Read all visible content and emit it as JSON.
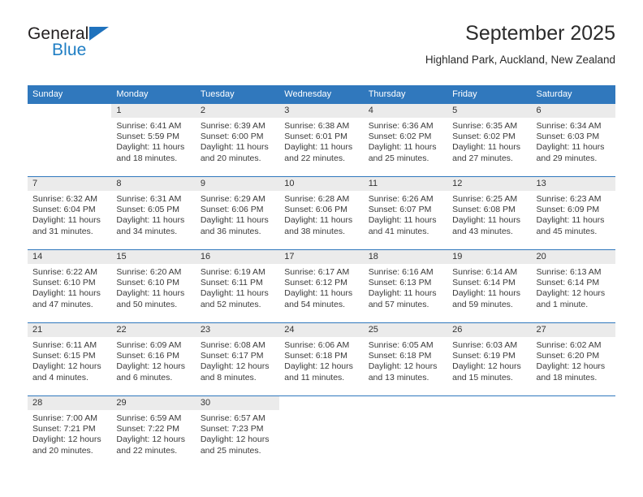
{
  "brand": {
    "name_top": "General",
    "name_bottom": "Blue",
    "triangle_icon": "triangle-icon",
    "accent_color": "#1f7ec4"
  },
  "header": {
    "title": "September 2025",
    "subtitle": "Highland Park, Auckland, New Zealand"
  },
  "theme": {
    "header_blue": "#3078bd",
    "daynum_band": "#ebebeb",
    "text": "#3a3a3a"
  },
  "calendar": {
    "weekday_headers": [
      "Sunday",
      "Monday",
      "Tuesday",
      "Wednesday",
      "Thursday",
      "Friday",
      "Saturday"
    ],
    "weeks": [
      [
        {
          "day": "",
          "sunrise": "",
          "sunset": "",
          "daylight_line1": "",
          "daylight_line2": ""
        },
        {
          "day": "1",
          "sunrise": "Sunrise: 6:41 AM",
          "sunset": "Sunset: 5:59 PM",
          "daylight_line1": "Daylight: 11 hours",
          "daylight_line2": "and 18 minutes."
        },
        {
          "day": "2",
          "sunrise": "Sunrise: 6:39 AM",
          "sunset": "Sunset: 6:00 PM",
          "daylight_line1": "Daylight: 11 hours",
          "daylight_line2": "and 20 minutes."
        },
        {
          "day": "3",
          "sunrise": "Sunrise: 6:38 AM",
          "sunset": "Sunset: 6:01 PM",
          "daylight_line1": "Daylight: 11 hours",
          "daylight_line2": "and 22 minutes."
        },
        {
          "day": "4",
          "sunrise": "Sunrise: 6:36 AM",
          "sunset": "Sunset: 6:02 PM",
          "daylight_line1": "Daylight: 11 hours",
          "daylight_line2": "and 25 minutes."
        },
        {
          "day": "5",
          "sunrise": "Sunrise: 6:35 AM",
          "sunset": "Sunset: 6:02 PM",
          "daylight_line1": "Daylight: 11 hours",
          "daylight_line2": "and 27 minutes."
        },
        {
          "day": "6",
          "sunrise": "Sunrise: 6:34 AM",
          "sunset": "Sunset: 6:03 PM",
          "daylight_line1": "Daylight: 11 hours",
          "daylight_line2": "and 29 minutes."
        }
      ],
      [
        {
          "day": "7",
          "sunrise": "Sunrise: 6:32 AM",
          "sunset": "Sunset: 6:04 PM",
          "daylight_line1": "Daylight: 11 hours",
          "daylight_line2": "and 31 minutes."
        },
        {
          "day": "8",
          "sunrise": "Sunrise: 6:31 AM",
          "sunset": "Sunset: 6:05 PM",
          "daylight_line1": "Daylight: 11 hours",
          "daylight_line2": "and 34 minutes."
        },
        {
          "day": "9",
          "sunrise": "Sunrise: 6:29 AM",
          "sunset": "Sunset: 6:06 PM",
          "daylight_line1": "Daylight: 11 hours",
          "daylight_line2": "and 36 minutes."
        },
        {
          "day": "10",
          "sunrise": "Sunrise: 6:28 AM",
          "sunset": "Sunset: 6:06 PM",
          "daylight_line1": "Daylight: 11 hours",
          "daylight_line2": "and 38 minutes."
        },
        {
          "day": "11",
          "sunrise": "Sunrise: 6:26 AM",
          "sunset": "Sunset: 6:07 PM",
          "daylight_line1": "Daylight: 11 hours",
          "daylight_line2": "and 41 minutes."
        },
        {
          "day": "12",
          "sunrise": "Sunrise: 6:25 AM",
          "sunset": "Sunset: 6:08 PM",
          "daylight_line1": "Daylight: 11 hours",
          "daylight_line2": "and 43 minutes."
        },
        {
          "day": "13",
          "sunrise": "Sunrise: 6:23 AM",
          "sunset": "Sunset: 6:09 PM",
          "daylight_line1": "Daylight: 11 hours",
          "daylight_line2": "and 45 minutes."
        }
      ],
      [
        {
          "day": "14",
          "sunrise": "Sunrise: 6:22 AM",
          "sunset": "Sunset: 6:10 PM",
          "daylight_line1": "Daylight: 11 hours",
          "daylight_line2": "and 47 minutes."
        },
        {
          "day": "15",
          "sunrise": "Sunrise: 6:20 AM",
          "sunset": "Sunset: 6:10 PM",
          "daylight_line1": "Daylight: 11 hours",
          "daylight_line2": "and 50 minutes."
        },
        {
          "day": "16",
          "sunrise": "Sunrise: 6:19 AM",
          "sunset": "Sunset: 6:11 PM",
          "daylight_line1": "Daylight: 11 hours",
          "daylight_line2": "and 52 minutes."
        },
        {
          "day": "17",
          "sunrise": "Sunrise: 6:17 AM",
          "sunset": "Sunset: 6:12 PM",
          "daylight_line1": "Daylight: 11 hours",
          "daylight_line2": "and 54 minutes."
        },
        {
          "day": "18",
          "sunrise": "Sunrise: 6:16 AM",
          "sunset": "Sunset: 6:13 PM",
          "daylight_line1": "Daylight: 11 hours",
          "daylight_line2": "and 57 minutes."
        },
        {
          "day": "19",
          "sunrise": "Sunrise: 6:14 AM",
          "sunset": "Sunset: 6:14 PM",
          "daylight_line1": "Daylight: 11 hours",
          "daylight_line2": "and 59 minutes."
        },
        {
          "day": "20",
          "sunrise": "Sunrise: 6:13 AM",
          "sunset": "Sunset: 6:14 PM",
          "daylight_line1": "Daylight: 12 hours",
          "daylight_line2": "and 1 minute."
        }
      ],
      [
        {
          "day": "21",
          "sunrise": "Sunrise: 6:11 AM",
          "sunset": "Sunset: 6:15 PM",
          "daylight_line1": "Daylight: 12 hours",
          "daylight_line2": "and 4 minutes."
        },
        {
          "day": "22",
          "sunrise": "Sunrise: 6:09 AM",
          "sunset": "Sunset: 6:16 PM",
          "daylight_line1": "Daylight: 12 hours",
          "daylight_line2": "and 6 minutes."
        },
        {
          "day": "23",
          "sunrise": "Sunrise: 6:08 AM",
          "sunset": "Sunset: 6:17 PM",
          "daylight_line1": "Daylight: 12 hours",
          "daylight_line2": "and 8 minutes."
        },
        {
          "day": "24",
          "sunrise": "Sunrise: 6:06 AM",
          "sunset": "Sunset: 6:18 PM",
          "daylight_line1": "Daylight: 12 hours",
          "daylight_line2": "and 11 minutes."
        },
        {
          "day": "25",
          "sunrise": "Sunrise: 6:05 AM",
          "sunset": "Sunset: 6:18 PM",
          "daylight_line1": "Daylight: 12 hours",
          "daylight_line2": "and 13 minutes."
        },
        {
          "day": "26",
          "sunrise": "Sunrise: 6:03 AM",
          "sunset": "Sunset: 6:19 PM",
          "daylight_line1": "Daylight: 12 hours",
          "daylight_line2": "and 15 minutes."
        },
        {
          "day": "27",
          "sunrise": "Sunrise: 6:02 AM",
          "sunset": "Sunset: 6:20 PM",
          "daylight_line1": "Daylight: 12 hours",
          "daylight_line2": "and 18 minutes."
        }
      ],
      [
        {
          "day": "28",
          "sunrise": "Sunrise: 7:00 AM",
          "sunset": "Sunset: 7:21 PM",
          "daylight_line1": "Daylight: 12 hours",
          "daylight_line2": "and 20 minutes."
        },
        {
          "day": "29",
          "sunrise": "Sunrise: 6:59 AM",
          "sunset": "Sunset: 7:22 PM",
          "daylight_line1": "Daylight: 12 hours",
          "daylight_line2": "and 22 minutes."
        },
        {
          "day": "30",
          "sunrise": "Sunrise: 6:57 AM",
          "sunset": "Sunset: 7:23 PM",
          "daylight_line1": "Daylight: 12 hours",
          "daylight_line2": "and 25 minutes."
        },
        {
          "day": "",
          "sunrise": "",
          "sunset": "",
          "daylight_line1": "",
          "daylight_line2": ""
        },
        {
          "day": "",
          "sunrise": "",
          "sunset": "",
          "daylight_line1": "",
          "daylight_line2": ""
        },
        {
          "day": "",
          "sunrise": "",
          "sunset": "",
          "daylight_line1": "",
          "daylight_line2": ""
        },
        {
          "day": "",
          "sunrise": "",
          "sunset": "",
          "daylight_line1": "",
          "daylight_line2": ""
        }
      ]
    ]
  }
}
